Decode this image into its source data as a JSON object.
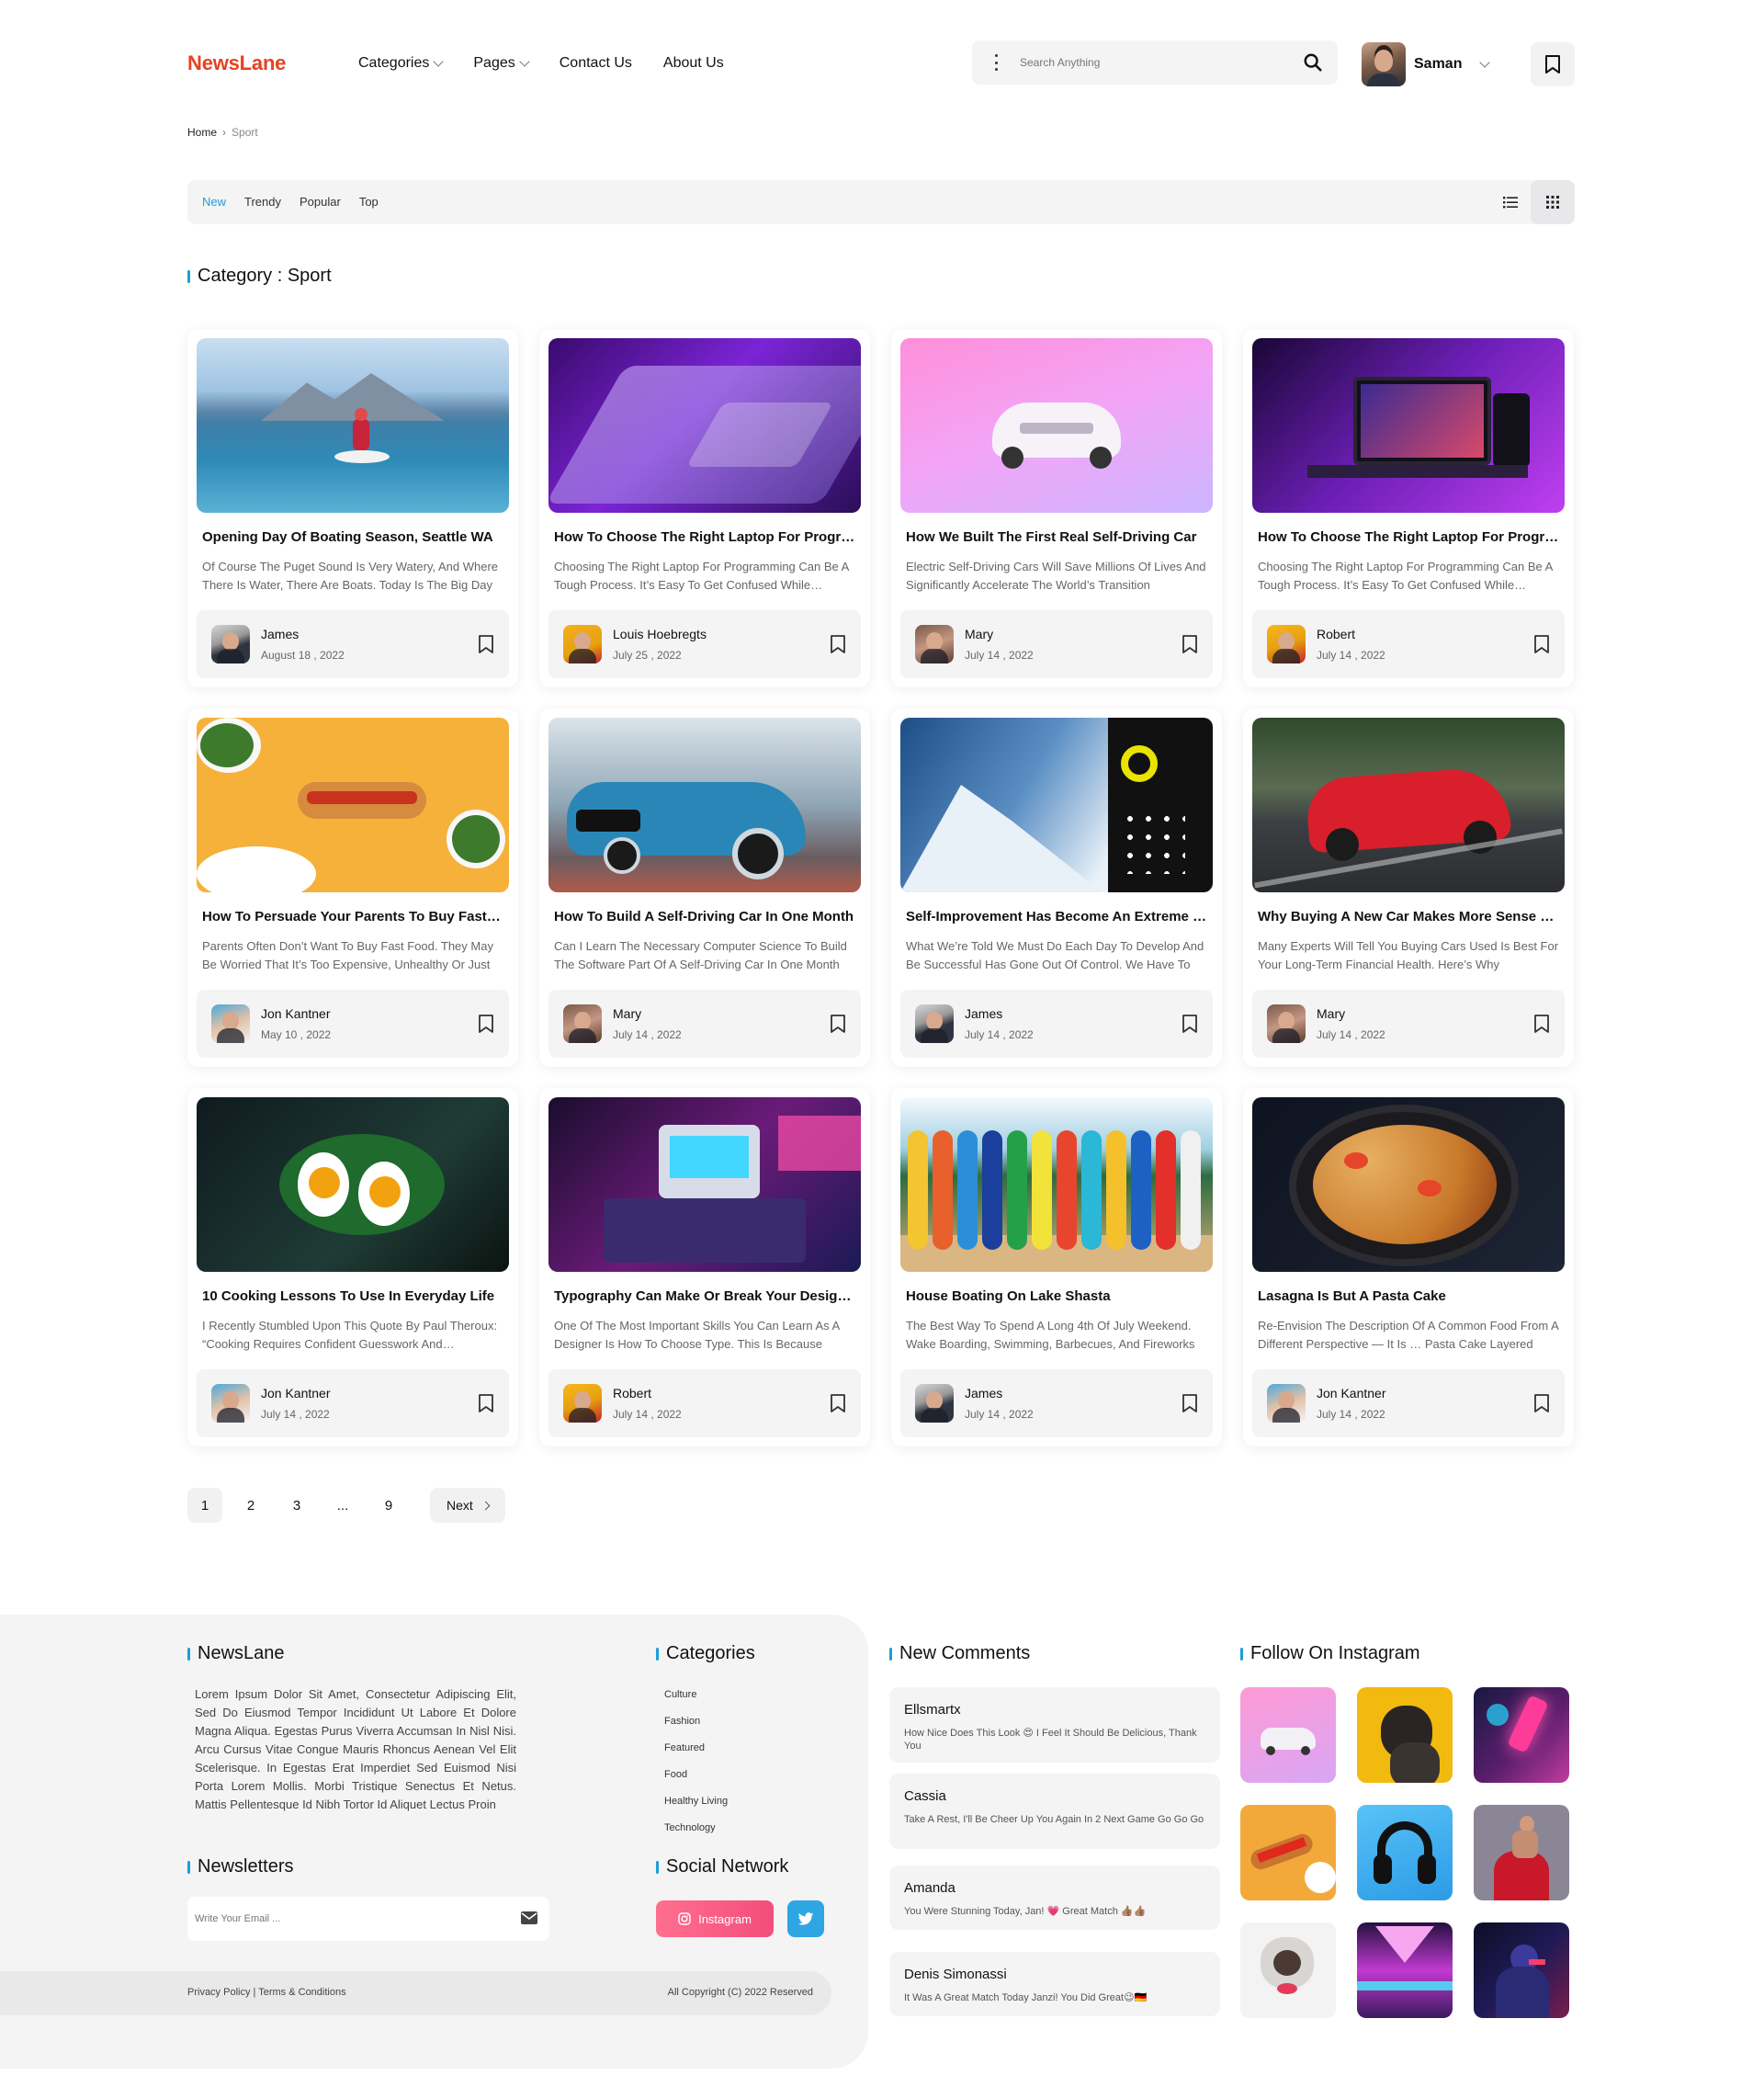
{
  "header": {
    "logo": "NewsLane",
    "nav": [
      {
        "label": "Categories",
        "dropdown": true
      },
      {
        "label": "Pages",
        "dropdown": true
      },
      {
        "label": "Contact Us",
        "dropdown": false
      },
      {
        "label": "About Us",
        "dropdown": false
      }
    ],
    "search_placeholder": "Search Anything",
    "user_name": "Saman"
  },
  "breadcrumb": {
    "home": "Home",
    "current": "Sport"
  },
  "tabs": [
    "New",
    "Trendy",
    "Popular",
    "Top"
  ],
  "active_tab": "New",
  "category_title": "Category : Sport",
  "accent_color": "#1a9fd6",
  "brand_color": "#e8411f",
  "cards": [
    {
      "title": "Opening Day Of Boating Season, Seattle WA",
      "excerpt": "Of Course The Puget Sound Is Very Watery, And Where There Is Water, There Are Boats. Today Is The Big Day",
      "author": "James",
      "date": "August 18 , 2022"
    },
    {
      "title": "How To Choose The Right Laptop For Programming",
      "excerpt": "Choosing The Right Laptop For Programming Can Be A Tough Process. It’s Easy To Get Confused While Researching",
      "author": "Louis Hoebregts",
      "date": "July 25 , 2022"
    },
    {
      "title": "How We Built The First Real Self-Driving Car",
      "excerpt": "Electric Self-Driving Cars Will Save Millions Of Lives And Significantly Accelerate The World’s Transition",
      "author": "Mary",
      "date": "July 14 , 2022"
    },
    {
      "title": "How To Choose The Right Laptop For Programming",
      "excerpt": "Choosing The Right Laptop For Programming Can Be A Tough Process. It’s Easy To Get Confused While Researching",
      "author": "Robert",
      "date": "July 14 , 2022"
    },
    {
      "title": "How To Persuade Your Parents To Buy Fast Food",
      "excerpt": "Parents Often Don’t Want To Buy Fast Food. They May Be Worried That It’s Too Expensive, Unhealthy Or Just",
      "author": "Jon Kantner",
      "date": "May 10 , 2022"
    },
    {
      "title": "How To Build A Self-Driving Car In One Month",
      "excerpt": "Can I Learn The Necessary Computer Science To Build The Software Part Of A Self-Driving Car In One Month",
      "author": "Mary",
      "date": "July 14 , 2022"
    },
    {
      "title": "Self-Improvement Has Become An Extreme Sport",
      "excerpt": "What We’re Told We Must Do Each Day To Develop And Be Successful Has Gone Out Of Control. We Have To",
      "author": "James",
      "date": "July 14 , 2022"
    },
    {
      "title": "Why Buying A New Car Makes More Sense Than Used",
      "excerpt": "Many Experts Will Tell You Buying Cars Used Is Best For Your Long-Term Financial Health. Here’s Why",
      "author": "Mary",
      "date": "July 14 , 2022"
    },
    {
      "title": "10 Cooking Lessons To Use In Everyday Life",
      "excerpt": "I Recently Stumbled Upon This Quote By Paul Theroux: “Cooking Requires Confident Guesswork And Improvisation”",
      "author": "Jon Kantner",
      "date": "July 14 , 2022"
    },
    {
      "title": "Typography Can Make Or Break Your Design Work",
      "excerpt": "One Of The Most Important Skills You Can Learn As A Designer Is How To Choose Type. This Is Because",
      "author": "Robert",
      "date": "July 14 , 2022"
    },
    {
      "title": "House Boating On Lake Shasta",
      "excerpt": "The Best Way To Spend A Long 4th Of July Weekend. Wake Boarding, Swimming, Barbecues, And Fireworks",
      "author": "James",
      "date": "July 14 , 2022"
    },
    {
      "title": "Lasagna Is But A Pasta Cake",
      "excerpt": "Re-Envision The Description Of A Common Food From A Different Perspective — It Is … Pasta Cake Layered",
      "author": "Jon Kantner",
      "date": "July 14 , 2022"
    }
  ],
  "pagination": {
    "pages": [
      "1",
      "2",
      "3",
      "...",
      "9"
    ],
    "active": "1",
    "next_label": "Next"
  },
  "footer": {
    "about_title": "NewsLane",
    "about_text": "Lorem Ipsum Dolor Sit Amet, Consectetur Adipiscing Elit, Sed Do Eiusmod Tempor Incididunt Ut Labore Et Dolore Magna Aliqua. Egestas Purus Viverra Accumsan In Nisl Nisi. Arcu Cursus Vitae Congue Mauris Rhoncus Aenean Vel Elit Scelerisque. In Egestas Erat Imperdiet Sed Euismod Nisi Porta Lorem Mollis. Morbi Tristique Senectus Et Netus. Mattis Pellentesque Id Nibh Tortor Id Aliquet Lectus Proin",
    "categories_title": "Categories",
    "categories": [
      "Culture",
      "Fashion",
      "Featured",
      "Food",
      "Healthy Living",
      "Technology"
    ],
    "newsletter_title": "Newsletters",
    "newsletter_placeholder": "Write Your Email ...",
    "social_title": "Social Network",
    "instagram_label": "Instagram",
    "comments_title": "New Comments",
    "comments": [
      {
        "name": "Ellsmartx",
        "text": "How Nice Does This Look 😍 I Feel It Should Be Delicious, Thank You"
      },
      {
        "name": "Cassia",
        "text": "Take A Rest, I'll Be Cheer Up You Again In 2 Next Game Go Go Go"
      },
      {
        "name": "Amanda",
        "text": "You Were Stunning Today, Jan! 💗 Great Match 👍🏽👍🏽"
      },
      {
        "name": "Denis Simonassi",
        "text": "It Was A Great Match Today Janzi! You Did Great😉🇩🇪"
      }
    ],
    "instagram_title": "Follow On Instagram",
    "legal_left": "Privacy Policy | Terms & Conditions",
    "legal_right": "All Copyright (C) 2022 Reserved"
  }
}
